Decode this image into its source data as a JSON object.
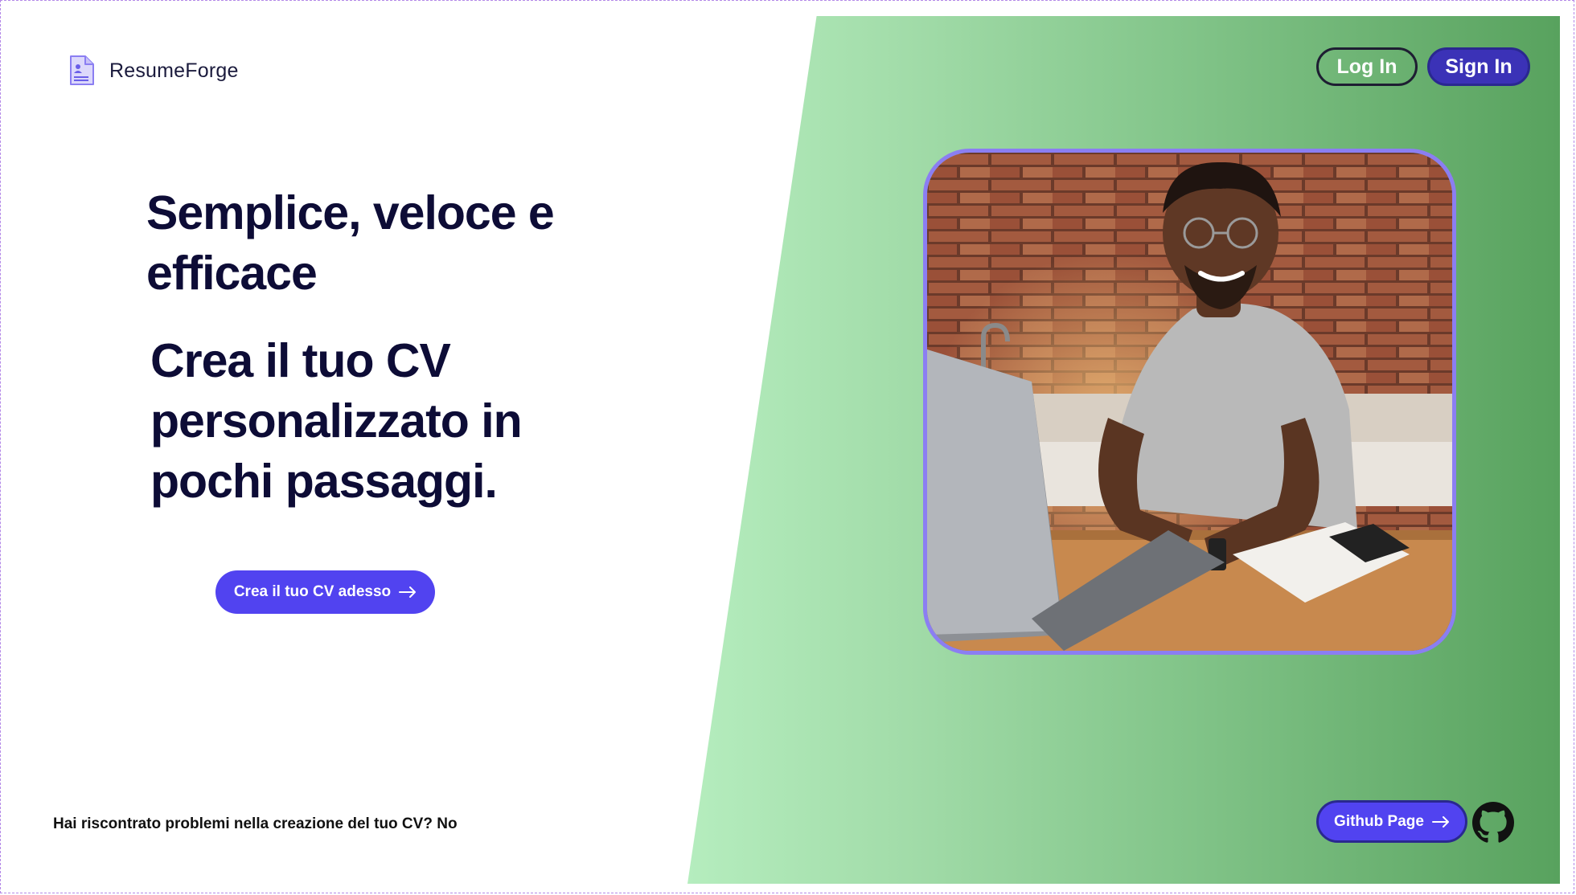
{
  "brand": {
    "name": "ResumeForge",
    "icon": "document-user-icon",
    "accent_color": "#5143f0"
  },
  "header": {
    "login_label": "Log In",
    "signin_label": "Sign In"
  },
  "hero": {
    "headline": "Semplice, veloce e efficace",
    "subheadline": "Crea il tuo CV personalizzato in pochi passaggi.",
    "cta_label": "Crea il tuo CV adesso",
    "cta_icon": "arrow-right-icon",
    "image": "smiling-man-typing-on-laptop-photo"
  },
  "footer": {
    "help_question": "Hai riscontrato problemi nella creazione del tuo CV?",
    "help_answer": "No",
    "github_label": "Github Page",
    "github_icon": "github-icon"
  },
  "colors": {
    "panel_gradient_light": "#b5edbe",
    "panel_gradient_dark": "#58a25e",
    "heading": "#0d0c36",
    "photo_border": "#8b7ef2"
  }
}
